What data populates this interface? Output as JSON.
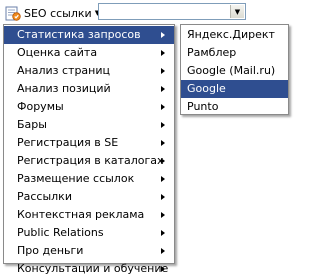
{
  "toolbar": {
    "seo_button": {
      "label": "SEO ссылки",
      "icon": "seo-links-icon",
      "arrow": "▼"
    },
    "combo": {
      "value": "",
      "arrow": "▼"
    }
  },
  "main_menu": {
    "items": [
      {
        "label": "Статистика запросов",
        "has_submenu": true,
        "highlighted": true
      },
      {
        "label": "Оценка сайта",
        "has_submenu": true
      },
      {
        "label": "Анализ страниц",
        "has_submenu": true
      },
      {
        "label": "Анализ позиций",
        "has_submenu": true
      },
      {
        "label": "Форумы",
        "has_submenu": true
      },
      {
        "label": "Бары",
        "has_submenu": true
      },
      {
        "label": "Регистрация в SE",
        "has_submenu": true
      },
      {
        "label": "Регистрация в каталогах",
        "has_submenu": true
      },
      {
        "label": "Размещение ссылок",
        "has_submenu": true
      },
      {
        "label": "Рассылки",
        "has_submenu": true
      },
      {
        "label": "Контекстная реклама",
        "has_submenu": true
      },
      {
        "label": "Public Relations",
        "has_submenu": true
      },
      {
        "label": "Про деньги",
        "has_submenu": true
      },
      {
        "label": "Консультации и обучение",
        "has_submenu": true
      }
    ]
  },
  "submenu": {
    "items": [
      {
        "label": "Яндекс.Директ"
      },
      {
        "label": "Рамблер"
      },
      {
        "label": "Google (Mail.ru)"
      },
      {
        "label": "Google",
        "highlighted": true
      },
      {
        "label": "Punto"
      }
    ]
  },
  "colors": {
    "highlight": "#2f4e90",
    "menu_border": "#8a8a8a",
    "combo_border": "#7f9db9"
  }
}
